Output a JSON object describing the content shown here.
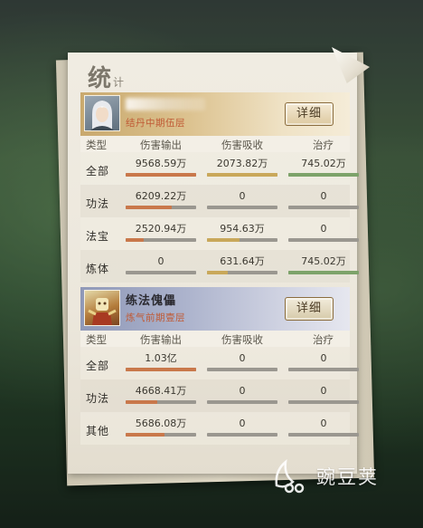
{
  "title": {
    "main": "统",
    "sub": "计"
  },
  "columns": [
    "类型",
    "伤害输出",
    "伤害吸收",
    "治疗"
  ],
  "detail_label": "详细",
  "player": {
    "realm": "结丹中期伍层",
    "rows": [
      {
        "label": "全部",
        "dmg": "9568.59万",
        "dmg_fill": 1.0,
        "abs": "2073.82万",
        "abs_fill": 1.0,
        "heal": "745.02万",
        "heal_fill": 1.0
      },
      {
        "label": "功法",
        "dmg": "6209.22万",
        "dmg_fill": 0.65,
        "abs": "0",
        "abs_fill": 0,
        "heal": "0",
        "heal_fill": 0
      },
      {
        "label": "法宝",
        "dmg": "2520.94万",
        "dmg_fill": 0.26,
        "abs": "954.63万",
        "abs_fill": 0.46,
        "heal": "0",
        "heal_fill": 0
      },
      {
        "label": "炼体",
        "dmg": "0",
        "dmg_fill": 0,
        "abs": "631.64万",
        "abs_fill": 0.3,
        "heal": "745.02万",
        "heal_fill": 1.0
      }
    ]
  },
  "puppet": {
    "name": "练法傀儡",
    "realm": "炼气前期壹层",
    "rows": [
      {
        "label": "全部",
        "dmg": "1.03亿",
        "dmg_fill": 1.0,
        "abs": "0",
        "abs_fill": 0,
        "heal": "0",
        "heal_fill": 0
      },
      {
        "label": "功法",
        "dmg": "4668.41万",
        "dmg_fill": 0.45,
        "abs": "0",
        "abs_fill": 0,
        "heal": "0",
        "heal_fill": 0
      },
      {
        "label": "其他",
        "dmg": "5686.08万",
        "dmg_fill": 0.55,
        "abs": "0",
        "abs_fill": 0,
        "heal": "0",
        "heal_fill": 0
      }
    ]
  },
  "watermark": "豌豆荚",
  "colors": {
    "damage": "#c9784b",
    "absorb": "#c9a85a",
    "heal": "#7da36a",
    "bar_bg": "#9a9790"
  }
}
